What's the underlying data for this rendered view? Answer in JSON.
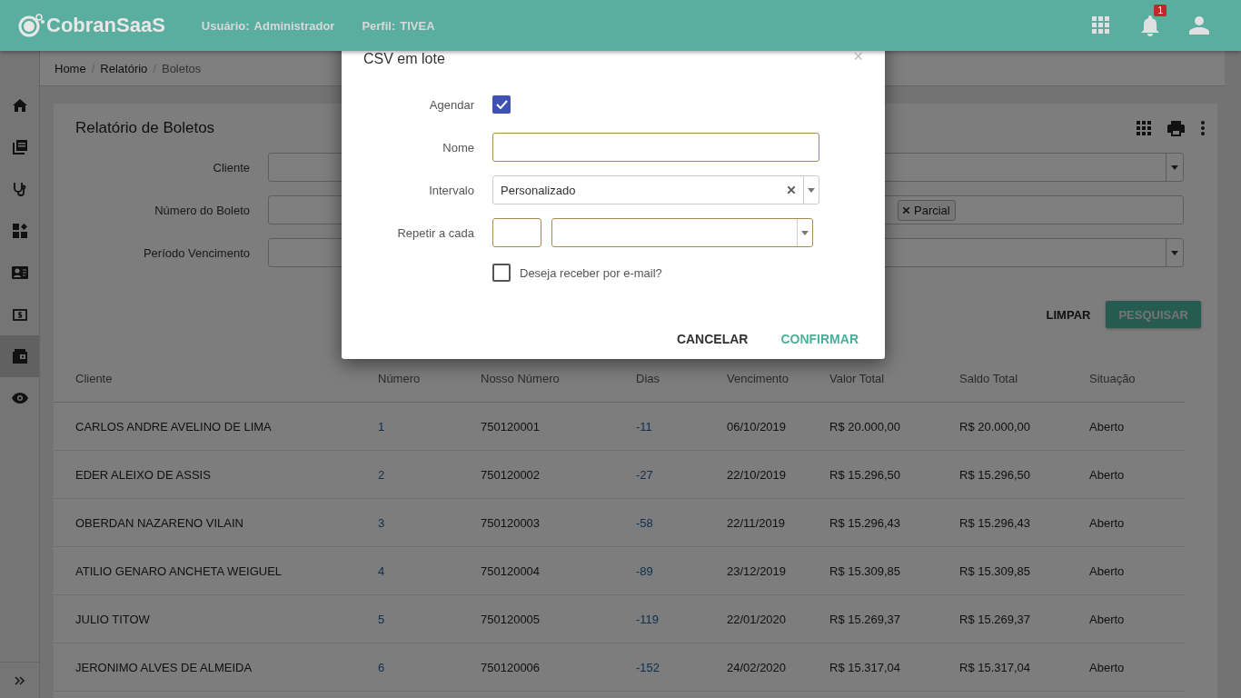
{
  "header": {
    "logo": "CobranSaaS",
    "user_label": "Usuário:",
    "user": "Administrador",
    "profile_label": "Perfil:",
    "profile": "TIVEA",
    "notification_count": "1"
  },
  "breadcrumb": {
    "separator": "/",
    "items": [
      {
        "label": "Home"
      },
      {
        "label": "Relatório"
      },
      {
        "label": "Boletos"
      }
    ]
  },
  "sidebar": {
    "items": [
      {
        "selected": false
      },
      {
        "selected": false
      },
      {
        "selected": false
      },
      {
        "selected": false
      },
      {
        "selected": false
      },
      {
        "selected": false
      },
      {
        "selected": true
      },
      {
        "selected": false
      }
    ]
  },
  "report": {
    "title": "Relatório de Boletos",
    "filters": [
      {
        "label": "Cliente",
        "kind": "select"
      },
      {
        "label": "Número do Boleto",
        "kind": "tags",
        "tags": [
          "Parcial"
        ]
      },
      {
        "label": "Período Vencimento",
        "kind": "select"
      }
    ],
    "buttons": [
      {
        "label": "LIMPAR",
        "kind": "text"
      },
      {
        "label": "PESQUISAR",
        "kind": "primary"
      }
    ]
  },
  "table": {
    "columns": [
      "Cliente",
      "Número",
      "Nosso Número",
      "Dias",
      "Vencimento",
      "Valor Total",
      "Saldo Total",
      "Situação"
    ],
    "rows": [
      [
        "CARLOS ANDRE AVELINO DE LIMA",
        "1",
        "750120001",
        "-11",
        "06/10/2019",
        "R$ 20.000,00",
        "R$ 20.000,00",
        "Aberto"
      ],
      [
        "EDER ALEIXO DE ASSIS",
        "2",
        "750120002",
        "-27",
        "22/10/2019",
        "R$ 15.296,50",
        "R$ 15.296,50",
        "Aberto"
      ],
      [
        "OBERDAN NAZARENO VILAIN",
        "3",
        "750120003",
        "-58",
        "22/11/2019",
        "R$ 15.296,43",
        "R$ 15.296,43",
        "Aberto"
      ],
      [
        "ATILIO GENARO ANCHETA WEIGUEL",
        "4",
        "750120004",
        "-89",
        "23/12/2019",
        "R$ 15.309,85",
        "R$ 15.309,85",
        "Aberto"
      ],
      [
        "JULIO TITOW",
        "5",
        "750120005",
        "-119",
        "22/01/2020",
        "R$ 15.269,37",
        "R$ 15.269,37",
        "Aberto"
      ],
      [
        "JERONIMO ALVES DE ALMEIDA",
        "6",
        "750120006",
        "-152",
        "24/02/2020",
        "R$ 15.317,04",
        "R$ 15.317,04",
        "Aberto"
      ]
    ]
  },
  "dialog": {
    "title": "CSV em lote",
    "close": "×",
    "fields": [
      {
        "label": "Agendar",
        "kind": "checkbox",
        "checked": true
      },
      {
        "label": "Nome",
        "kind": "text"
      },
      {
        "label": "Intervalo",
        "kind": "select",
        "value": "Personalizado"
      },
      {
        "label": "Repetir a cada",
        "kind": "repeat"
      }
    ],
    "email": {
      "label": "Deseja receber por e-mail?",
      "checked": false
    },
    "buttons": [
      {
        "label": "CANCELAR",
        "kind": "text"
      },
      {
        "label": "CONFIRMAR",
        "kind": "primary"
      }
    ]
  }
}
